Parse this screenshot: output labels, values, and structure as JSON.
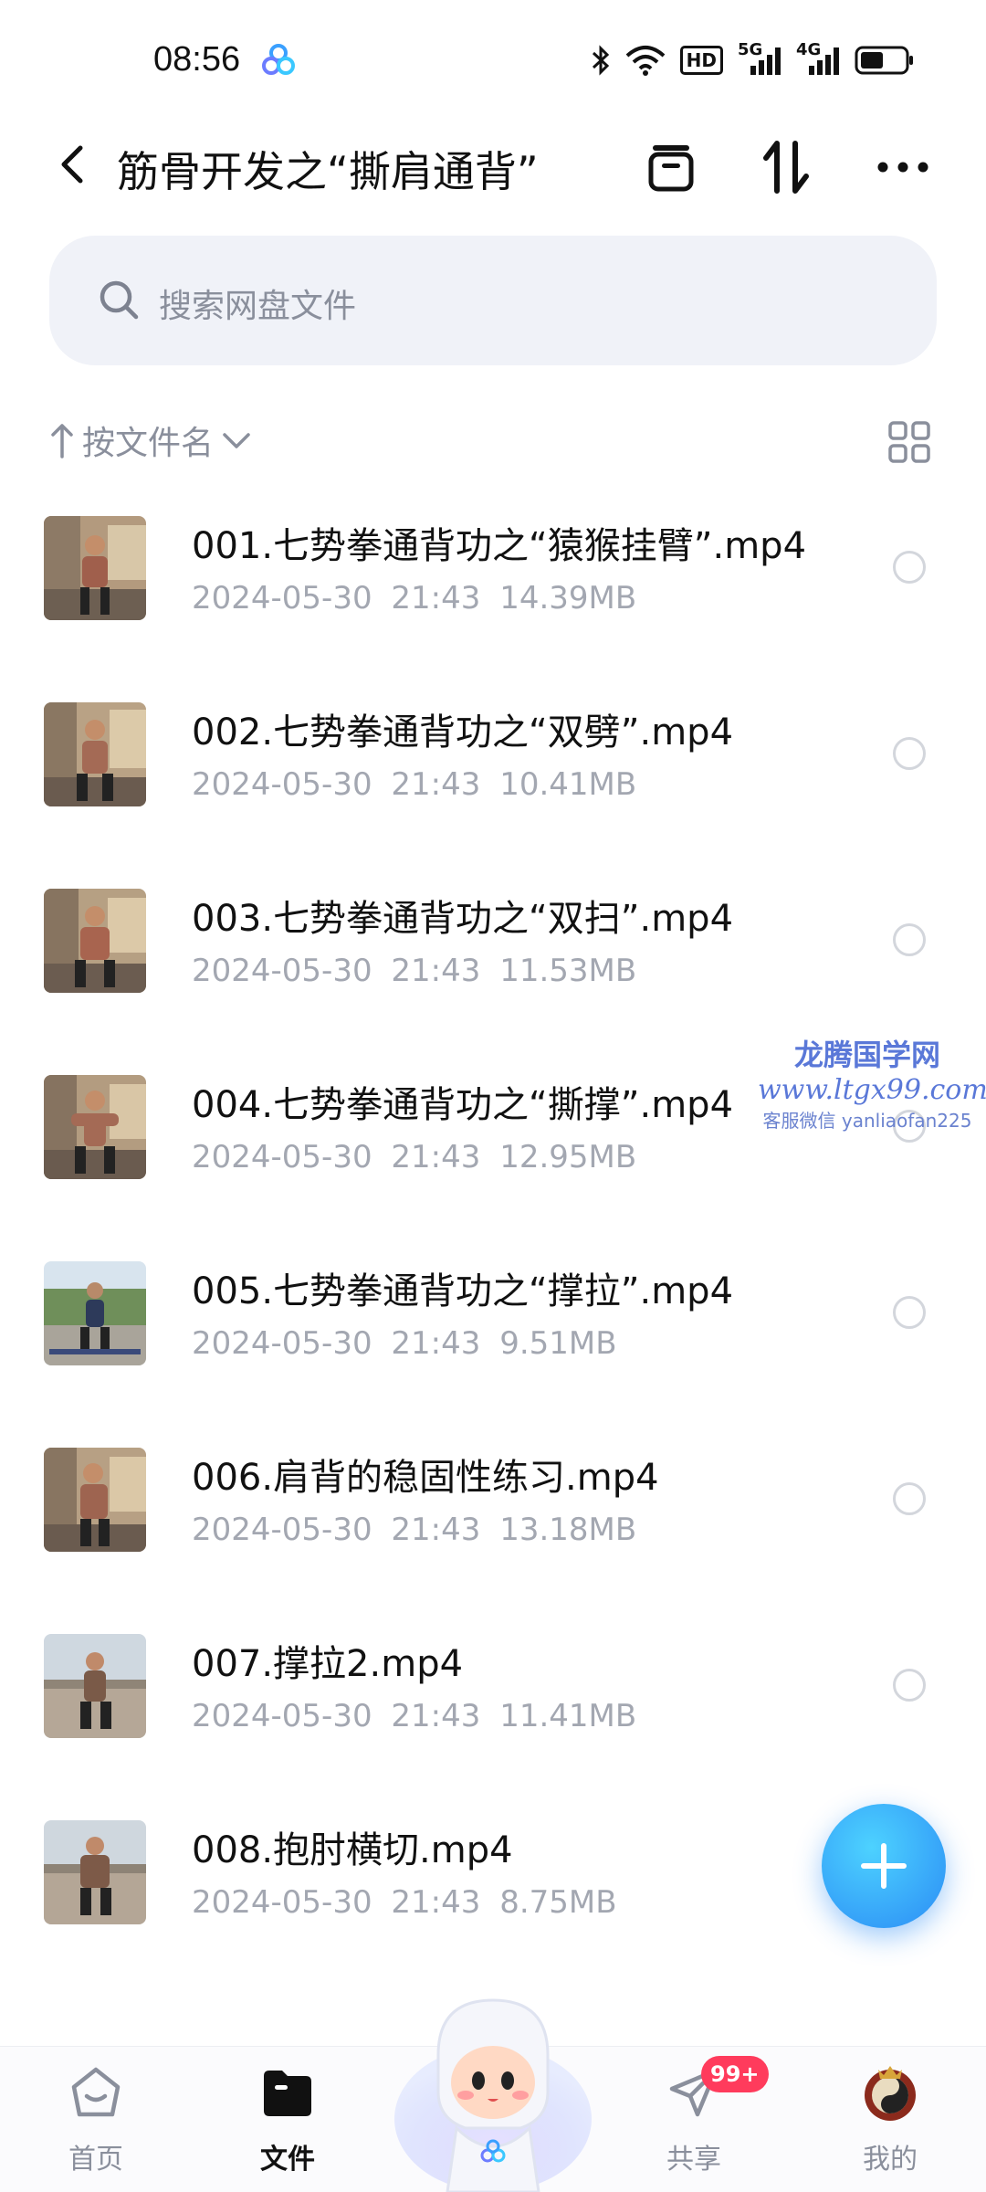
{
  "status_bar": {
    "time": "08:56",
    "network_5g": "5G",
    "network_4g": "4G",
    "hd_label": "HD"
  },
  "header": {
    "title": "筋骨开发之“撕肩通背”",
    "icons": [
      "back-icon",
      "archive-icon",
      "sort-icon",
      "more-icon"
    ]
  },
  "search": {
    "placeholder": "搜索网盘文件"
  },
  "sort": {
    "label": "按文件名"
  },
  "files": [
    {
      "name": "001.七势拳通背功之“猿猴挂臂”.mp4",
      "date": "2024-05-30",
      "time": "21:43",
      "size": "14.39MB"
    },
    {
      "name": "002.七势拳通背功之“双劈”.mp4",
      "date": "2024-05-30",
      "time": "21:43",
      "size": "10.41MB"
    },
    {
      "name": "003.七势拳通背功之“双扫”.mp4",
      "date": "2024-05-30",
      "time": "21:43",
      "size": "11.53MB"
    },
    {
      "name": "004.七势拳通背功之“撕撑”.mp4",
      "date": "2024-05-30",
      "time": "21:43",
      "size": "12.95MB"
    },
    {
      "name": "005.七势拳通背功之“撑拉”.mp4",
      "date": "2024-05-30",
      "time": "21:43",
      "size": "9.51MB"
    },
    {
      "name": "006.肩背的稳固性练习.mp4",
      "date": "2024-05-30",
      "time": "21:43",
      "size": "13.18MB"
    },
    {
      "name": "007.撑拉2.mp4",
      "date": "2024-05-30",
      "time": "21:43",
      "size": "11.41MB"
    },
    {
      "name": "008.抱肘横切.mp4",
      "date": "2024-05-30",
      "time": "21:43",
      "size": "8.75MB"
    }
  ],
  "watermark": {
    "title": "龙腾国学网",
    "url": "www.ltgx99.com",
    "wechat": "客服微信 yanliaofan225"
  },
  "bottom_nav": {
    "home": "首页",
    "files": "文件",
    "share": "共享",
    "mine": "我的",
    "share_badge": "99+"
  },
  "colors": {
    "accent": "#2b8cf5",
    "badge": "#ff3b5c",
    "meta_text": "#a3a7b1"
  }
}
